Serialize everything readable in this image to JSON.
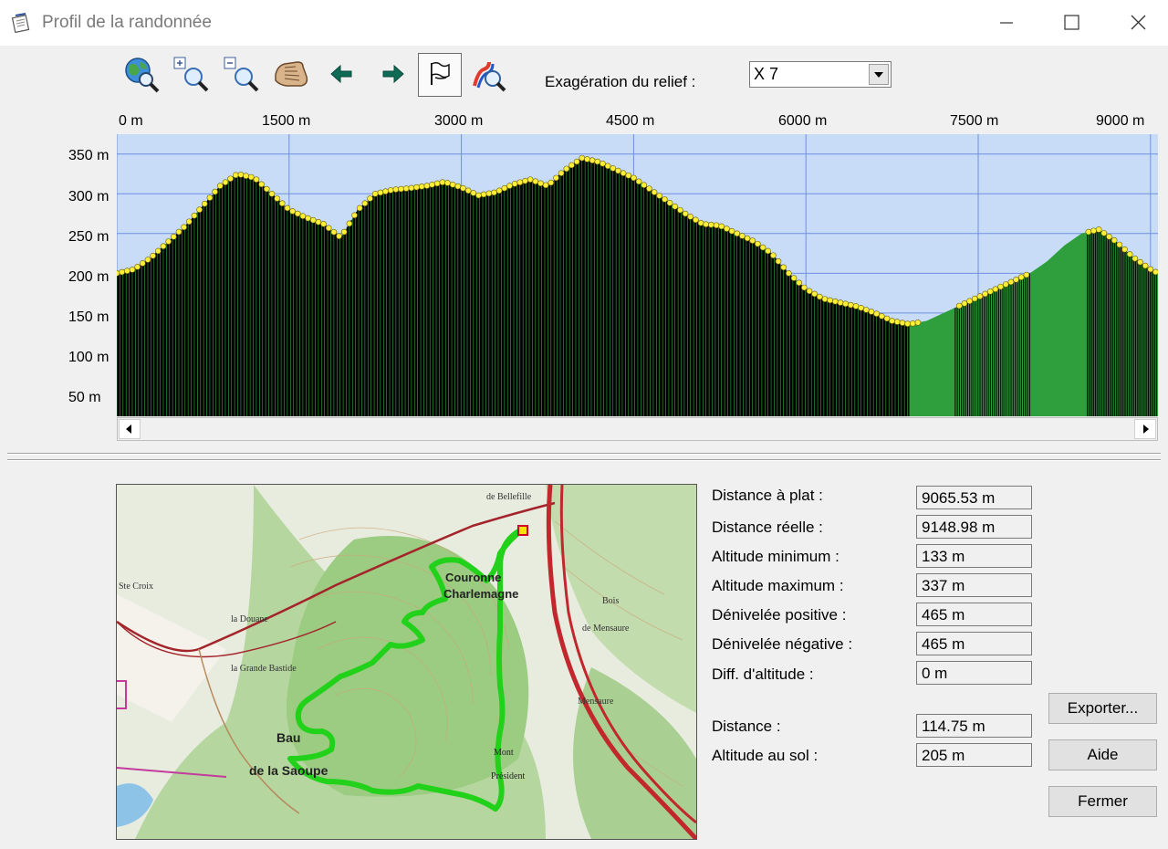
{
  "window": {
    "title": "Profil de la randonnée"
  },
  "toolbar": {
    "buttons": [
      {
        "name": "globe-search-icon"
      },
      {
        "name": "zoom-in-icon"
      },
      {
        "name": "zoom-out-icon"
      },
      {
        "name": "pan-hand-icon"
      },
      {
        "name": "arrow-left-icon"
      },
      {
        "name": "arrow-right-icon"
      },
      {
        "name": "flags-icon",
        "pressed": true
      },
      {
        "name": "route-zoom-icon"
      }
    ],
    "exaggeration_label": "Exagération du relief :",
    "exaggeration_value": "X 7"
  },
  "chart_data": {
    "type": "area",
    "x_axis_labels": [
      "0 m",
      "1500 m",
      "3000 m",
      "4500 m",
      "6000 m",
      "7500 m",
      "9000 m"
    ],
    "y_axis_labels": [
      "350 m",
      "300 m",
      "250 m",
      "200 m",
      "150 m",
      "100 m",
      "50 m"
    ],
    "xlim": [
      0,
      9065
    ],
    "ylim": [
      20,
      375
    ],
    "x_unit": "m",
    "y_unit": "m",
    "grid": true,
    "colors": {
      "sky": "#c8dcf8",
      "terrain": "#2f9e3c",
      "terrain_dark": "#000000",
      "point": "#ffef3a",
      "grid": "#6f8fe0"
    },
    "x": [
      0,
      150,
      300,
      450,
      600,
      750,
      900,
      1050,
      1200,
      1350,
      1500,
      1650,
      1800,
      1950,
      2100,
      2250,
      2400,
      2550,
      2700,
      2850,
      3000,
      3150,
      3300,
      3450,
      3600,
      3750,
      3900,
      4050,
      4200,
      4350,
      4500,
      4650,
      4800,
      4950,
      5100,
      5250,
      5400,
      5550,
      5700,
      5850,
      6000,
      6150,
      6300,
      6450,
      6600,
      6750,
      6900,
      7050,
      7200,
      7350,
      7500,
      7650,
      7800,
      7950,
      8100,
      8250,
      8400,
      8550,
      8700,
      8850,
      9000,
      9065
    ],
    "y": [
      200,
      205,
      220,
      240,
      260,
      285,
      310,
      325,
      320,
      300,
      280,
      270,
      262,
      245,
      280,
      300,
      305,
      307,
      310,
      315,
      308,
      298,
      302,
      312,
      318,
      310,
      330,
      345,
      340,
      330,
      320,
      305,
      290,
      275,
      262,
      260,
      250,
      240,
      225,
      200,
      180,
      168,
      163,
      158,
      150,
      140,
      136,
      140,
      150,
      160,
      170,
      180,
      190,
      200,
      215,
      235,
      250,
      255,
      240,
      220,
      205,
      200
    ]
  },
  "stats": [
    {
      "label": "Distance à plat :",
      "value": "9065.53 m"
    },
    {
      "label": "Distance réelle :",
      "value": "9148.98 m"
    },
    {
      "label": "Altitude minimum :",
      "value": "133 m"
    },
    {
      "label": "Altitude maximum :",
      "value": "337 m"
    },
    {
      "label": "Dénivelée positive :",
      "value": "465 m"
    },
    {
      "label": "Dénivelée négative :",
      "value": "465 m"
    },
    {
      "label": "Diff. d'altitude :",
      "value": "0 m"
    }
  ],
  "cursor": [
    {
      "label": "Distance :",
      "value": "114.75 m"
    },
    {
      "label": "Altitude au sol :",
      "value": "205 m"
    }
  ],
  "buttons": {
    "export": "Exporter...",
    "help": "Aide",
    "close": "Fermer"
  },
  "map": {
    "labels": [
      "Couronne",
      "Charlemagne",
      "Bau",
      "de la Saoupe",
      "Mont",
      "Président",
      "la Grande Bastide",
      "la Douane",
      "Ste Croix",
      "de Bellefille",
      "Bois",
      "de Mensaure",
      "Mensaure"
    ]
  }
}
